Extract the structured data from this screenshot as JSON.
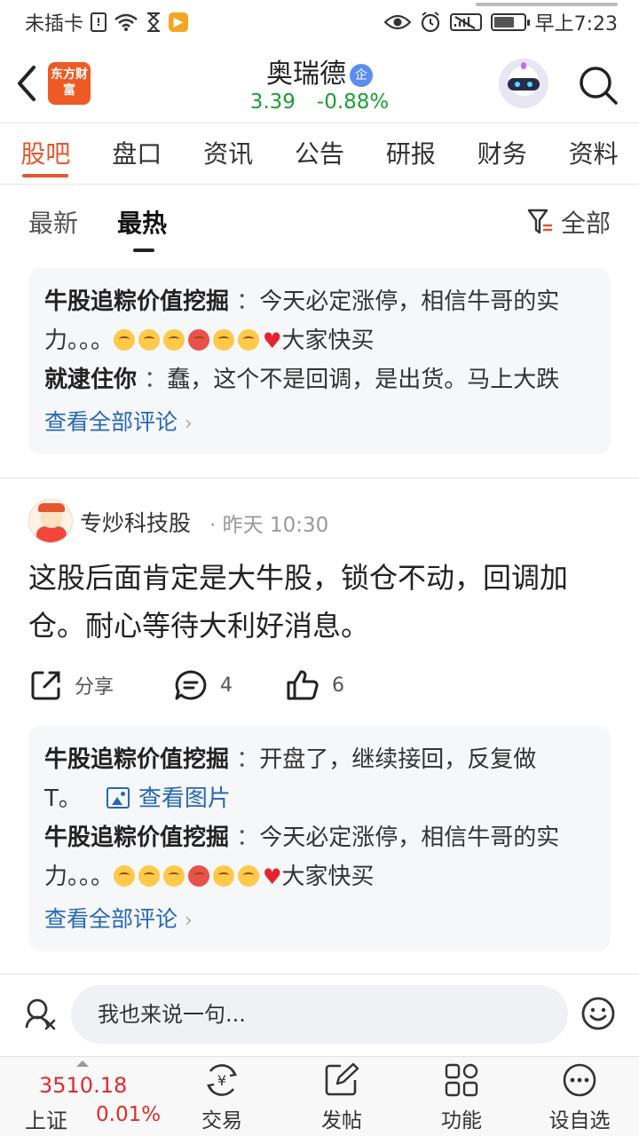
{
  "status_bar": {
    "carrier": "未插卡",
    "time": "早上7:23",
    "sim_icon": "!"
  },
  "header": {
    "logo_text": "东方财富",
    "stock_name": "奥瑞德",
    "badge": "企",
    "price": "3.39",
    "change": "-0.88%",
    "price_color": "#1aa033"
  },
  "tabs": [
    {
      "label": "股吧",
      "active": true
    },
    {
      "label": "盘口"
    },
    {
      "label": "资讯"
    },
    {
      "label": "公告"
    },
    {
      "label": "研报"
    },
    {
      "label": "财务"
    },
    {
      "label": "资料"
    }
  ],
  "subtabs": {
    "latest": "最新",
    "hottest": "最热",
    "filter": "全部"
  },
  "comment_box_1": {
    "c1_user": "牛股追粽价值挖掘",
    "c1_text_a": "今天必定涨停，相信牛哥的实",
    "c1_text_b": "力。。。",
    "c1_text_c": "大家快买",
    "c2_user": "就逮住你",
    "c2_text": "蠢，这个不是回调，是出货。马上大跌",
    "view_all": "查看全部评论"
  },
  "post": {
    "author": "专炒科技股",
    "time": "昨天 10:30",
    "body": "这股后面肯定是大牛股，锁仓不动，回调加仓。耐心等待大利好消息。",
    "share_label": "分享",
    "comment_count": "4",
    "like_count": "6"
  },
  "comment_box_2": {
    "c1_user": "牛股追粽价值挖掘",
    "c1_text_a": "开盘了，继续接回，反复做",
    "c1_text_b": "T。",
    "c1_image_link": "查看图片",
    "c2_user": "牛股追粽价值挖掘",
    "c2_text_a": "今天必定涨停，相信牛哥的实",
    "c2_text_b": "力。。。",
    "c2_text_c": "大家快买",
    "view_all": "查看全部评论"
  },
  "input_bar": {
    "placeholder": "我也来说一句..."
  },
  "bottom_nav": {
    "index_value": "3510.18",
    "index_name": "上证",
    "index_pct": "0.01%",
    "items": [
      "交易",
      "发帖",
      "功能",
      "设自选"
    ]
  },
  "colors": {
    "accent": "#e4572e",
    "link": "#2668b8",
    "up": "#e02b2b",
    "down": "#1aa033"
  }
}
